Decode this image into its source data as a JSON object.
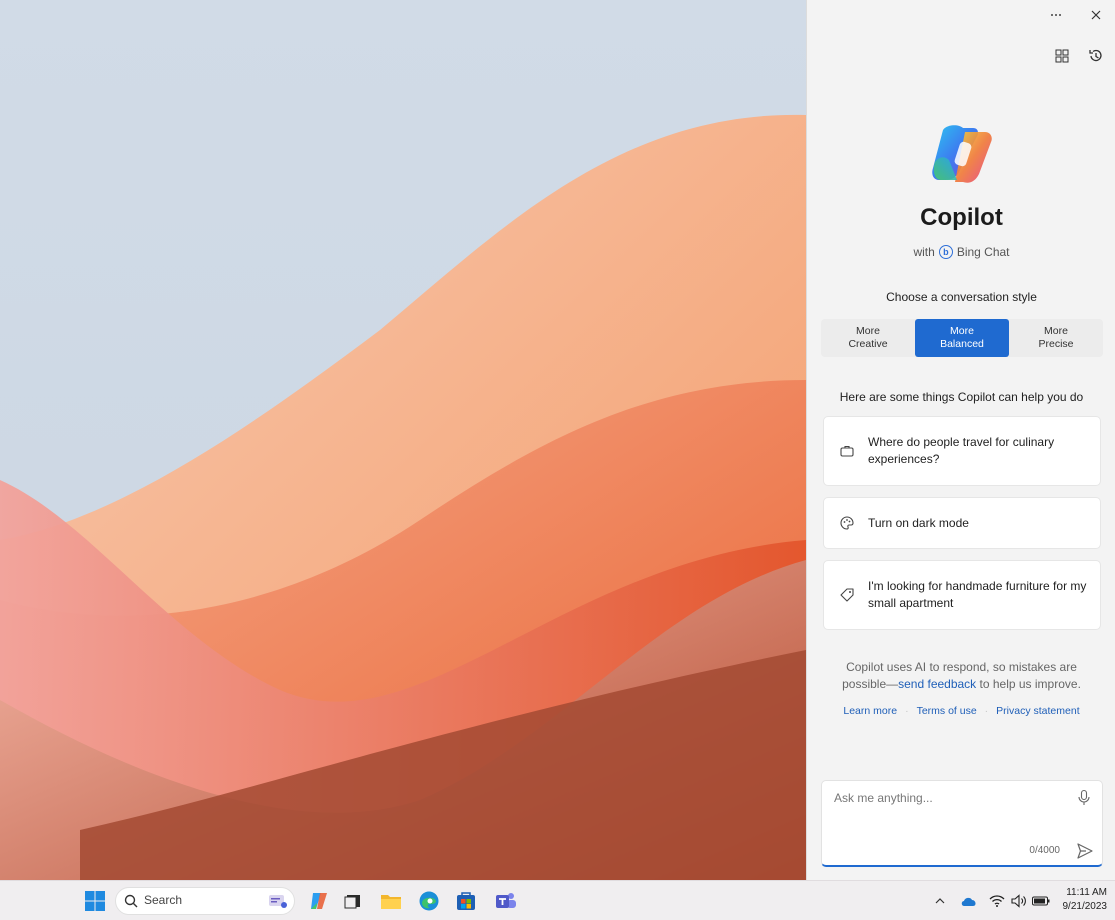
{
  "panel": {
    "title": "Copilot",
    "with_label": "with",
    "bing_label": "Bing Chat",
    "style_label": "Choose a conversation style",
    "styles": [
      {
        "label": "More\nCreative",
        "active": false
      },
      {
        "label": "More\nBalanced",
        "active": true
      },
      {
        "label": "More\nPrecise",
        "active": false
      }
    ],
    "help_label": "Here are some things Copilot can help you do",
    "suggestions": [
      {
        "text": "Where do people travel for culinary experiences?",
        "icon": "briefcase-icon"
      },
      {
        "text": "Turn on dark mode",
        "icon": "palette-icon"
      },
      {
        "text": "I'm looking for handmade furniture for my small apartment",
        "icon": "tag-icon"
      }
    ],
    "disclaimer_pre": "Copilot uses AI to respond, so mistakes are possible—",
    "disclaimer_link": "send feedback",
    "disclaimer_post": " to help us improve.",
    "links": [
      "Learn more",
      "Terms of use",
      "Privacy statement"
    ],
    "input_placeholder": "Ask me anything...",
    "counter": "0/4000"
  },
  "taskbar": {
    "search_placeholder": "Search",
    "time": "11:11 AM",
    "date": "9/21/2023"
  },
  "colors": {
    "accent": "#1f6ad0",
    "link": "#1f5fb8"
  }
}
